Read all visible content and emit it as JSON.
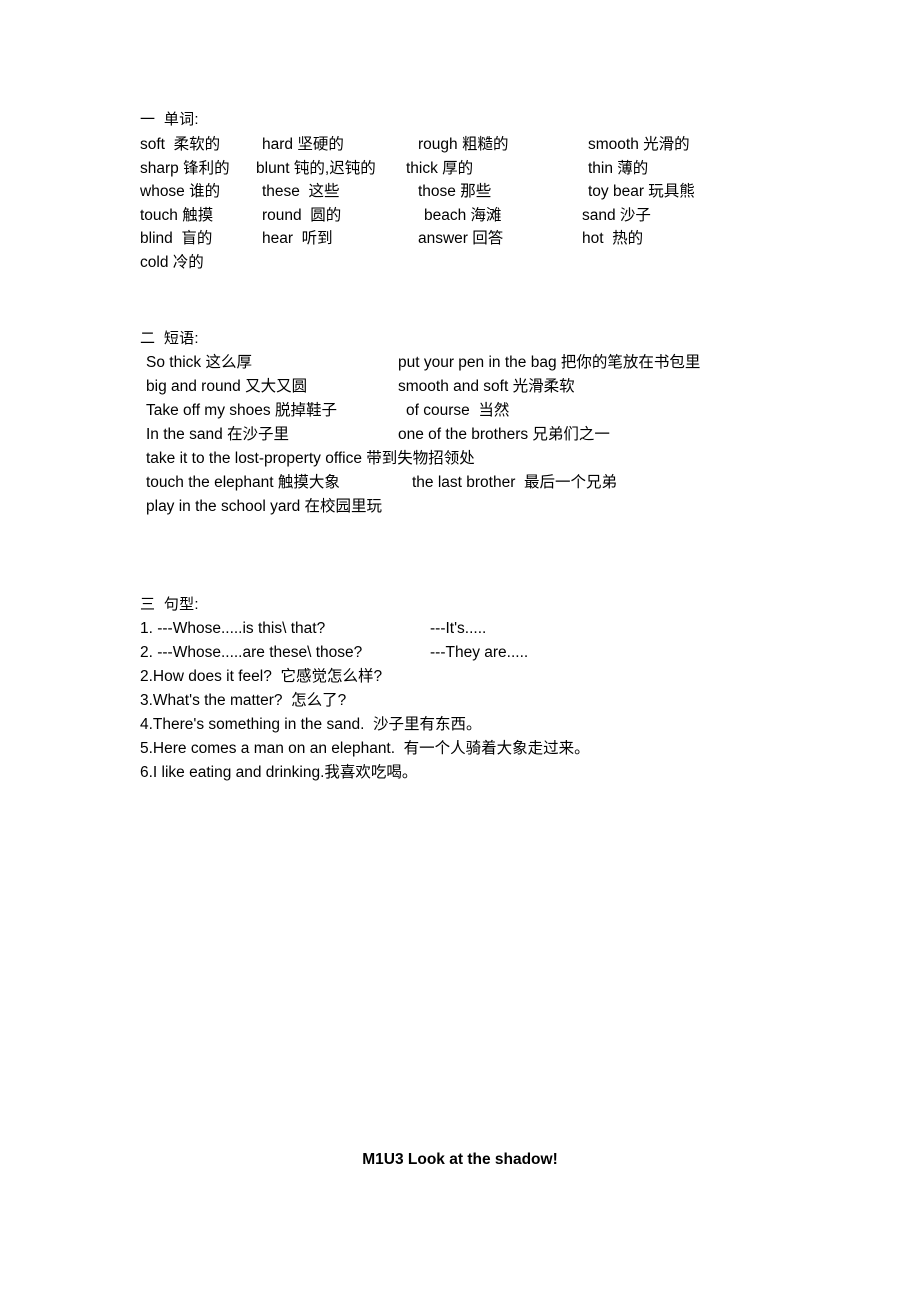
{
  "document": {
    "background_color": "#ffffff",
    "text_color": "#000000"
  },
  "sections": {
    "vocabulary": {
      "heading": "一  单词:",
      "rows": [
        [
          "soft  柔软的",
          "hard 坚硬的",
          "rough 粗糙的",
          "smooth 光滑的"
        ],
        [
          "sharp 锋利的",
          "blunt 钝的,迟钝的",
          "thick 厚的",
          "thin 薄的"
        ],
        [
          "whose 谁的",
          "these  这些",
          "those 那些",
          "toy bear 玩具熊"
        ],
        [
          "touch 触摸",
          "round  圆的",
          "beach 海滩",
          "sand 沙子"
        ],
        [
          "blind  盲的",
          "hear  听到",
          "answer 回答",
          "hot  热的"
        ],
        [
          "cold 冷的",
          "",
          "",
          ""
        ]
      ]
    },
    "phrases": {
      "heading": "二  短语:",
      "rows": [
        [
          "So thick 这么厚",
          "put your pen in the bag 把你的笔放在书包里"
        ],
        [
          "big and round 又大又圆",
          "smooth and soft 光滑柔软"
        ],
        [
          "Take off my shoes 脱掉鞋子",
          "of course  当然"
        ],
        [
          "In the sand 在沙子里",
          "one of the brothers 兄弟们之一"
        ],
        [
          "take it to the lost-property office 带到失物招领处",
          ""
        ],
        [
          "touch the elephant 触摸大象",
          "the last brother  最后一个兄弟"
        ],
        [
          "play in the school yard 在校园里玩",
          ""
        ]
      ]
    },
    "sentence_patterns": {
      "heading": "三  句型:",
      "rows": [
        [
          "1. ---Whose.....is this\\ that?",
          "---It's....."
        ],
        [
          "2. ---Whose.....are these\\ those?",
          "---They are....."
        ],
        [
          "2.How does it feel?  它感觉怎么样?",
          ""
        ],
        [
          "3.What's the matter?  怎么了?",
          ""
        ],
        [
          "4.There's something in the sand.  沙子里有东西。",
          ""
        ],
        [
          "5.Here comes a man on an elephant.  有一个人骑着大象走过来。",
          ""
        ],
        [
          "6.I like eating and drinking.我喜欢吃喝。",
          ""
        ]
      ]
    }
  },
  "footer": {
    "title": "M1U3 Look at the shadow!"
  }
}
